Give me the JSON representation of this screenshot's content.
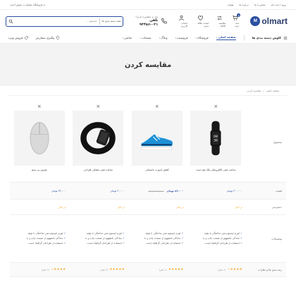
{
  "topbar": {
    "promo": "به فروشگاه مولمارت خوش آمدید",
    "links": [
      "ورود / ثبت نام",
      "تماس با ما",
      "درباره ما",
      "پشتیبانی"
    ],
    "currency": "تومان"
  },
  "header": {
    "logo_text": "olmart",
    "logo_mark": "M",
    "search_placeholder": "جستجو ...",
    "search_category": "همه دسته بندی ها",
    "phone_label": "نیاز به مشاوره دارید؟",
    "phone_number": "تلفن ۰۲۱-۹۳۴۵۶",
    "icons": [
      {
        "name": "user-icon",
        "label": "حساب کاربری"
      },
      {
        "name": "heart-icon",
        "label": "لیست علاقه مندی"
      },
      {
        "name": "compare-icon",
        "label": "مقایسه کالاها"
      },
      {
        "name": "cart-icon",
        "label": "سبد خرید",
        "badge": "0"
      }
    ]
  },
  "nav": {
    "categories": "کاوش دسته بندی ها",
    "items": [
      {
        "label": "صفحه اصلی",
        "active": true
      },
      {
        "label": "فروشگاه"
      },
      {
        "label": "فروشنده"
      },
      {
        "label": "وبلاگ"
      },
      {
        "label": "صفحات"
      },
      {
        "label": "عناصر"
      }
    ],
    "track": "پیگیری سفارش",
    "deals": "فروش ویژه"
  },
  "banner": {
    "title": "مقایسه کردن"
  },
  "breadcrumb": {
    "home": "صفحه اصلی",
    "sep": "/",
    "current": "مقایسه کردن"
  },
  "compare": {
    "labels": {
      "product": "محصول",
      "price": "قیمت",
      "availability": "دسترسی",
      "description": "توضیحات",
      "rating": "رتبه بندی ها و نظرات"
    },
    "products": [
      {
        "name": "ساعت مچی الکترونیکی بلک مچ دست",
        "image": "fitness-band",
        "price_new": "۳۰۰,۰۰۰ تومان",
        "price_old": "",
        "availability": "در انبار",
        "rating": 4,
        "reviews": "(۲ نظر)"
      },
      {
        "name": "کفش اسپرت تابستانی",
        "image": "sneaker",
        "price_new": "۸۶,۰۰۰ تومان",
        "price_old": "۱۰۲,۰۰۰ تومان",
        "availability": "در انبار",
        "rating": 5,
        "reviews": "(۱ نظر)"
      },
      {
        "name": "ساعت مچی مشکی طراحی",
        "image": "smart-watch",
        "price_new": "۴۰,۰۰۰ تومان",
        "price_old": "",
        "availability": "در انبار",
        "rating": 5,
        "reviews": "(۳ نظر)"
      },
      {
        "name": "ماوس بی سیم",
        "image": "mouse",
        "price_new": "۳۲,۰۰۰ تومان",
        "price_old": "",
        "availability": "در انبار",
        "rating": 4,
        "reviews": "(۲ نظر)"
      }
    ],
    "description_lines": [
      "لورم ایپسوم متن ساختگی با تولید",
      "سادگی نامفهوم از صنعت چاپ و با",
      "استفاده از طراحان گرافیک است."
    ]
  },
  "colors": {
    "accent": "#2a4fa0",
    "star": "#f5a623"
  }
}
